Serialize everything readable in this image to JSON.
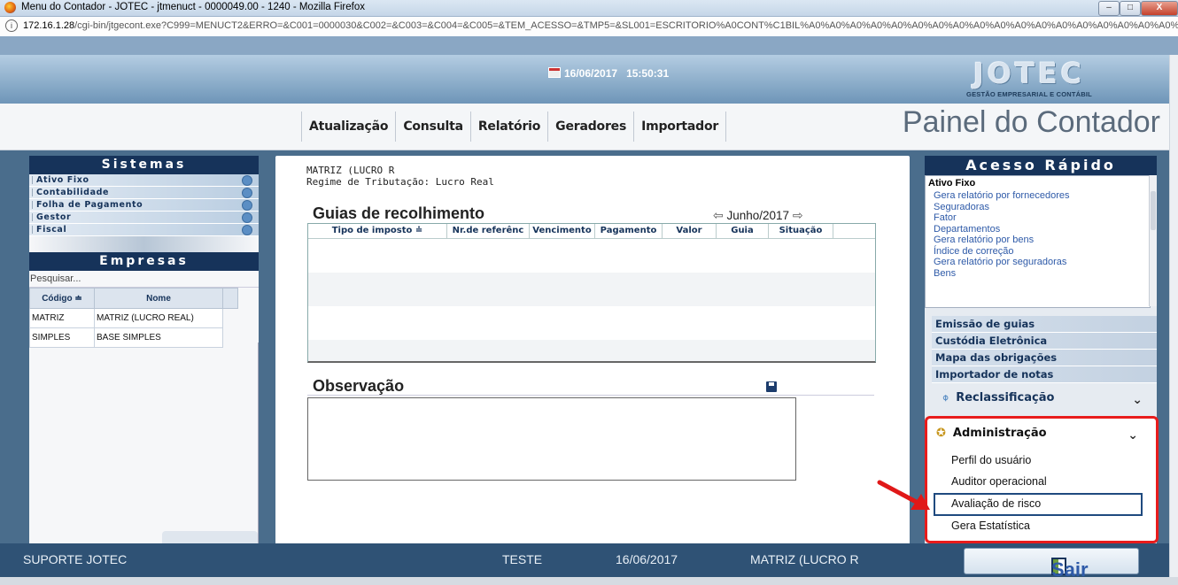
{
  "window": {
    "title": "Menu do Contador - JOTEC - jtmenuct - 0000049.00 - 1240 - Mozilla Firefox",
    "min_label": "‒",
    "max_label": "□",
    "close_label": "X"
  },
  "urlbar": {
    "host": "172.16.1.28",
    "path": "/cgi-bin/jtgecont.exe?C999=MENUCT2&ERRO=&C001=0000030&C002=&C003=&C004=&C005=&TEM_ACESSO=&TMP5=&SL001=ESCRITORIO%A0CONT%C1BIL%A0%A0%A0%A0%A0%A0%A0%A0%A0%A0%A0%A0%A0%A0%A0%A0%A0%A0%A0%"
  },
  "banner": {
    "date": "16/06/2017",
    "time": "15:50:31",
    "logo_text": "JOTEC",
    "logo_subtitle": "GESTÃO EMPRESARIAL E CONTÁBIL"
  },
  "menu": {
    "items": [
      "Atualização",
      "Consulta",
      "Relatório",
      "Geradores",
      "Importador"
    ],
    "page_title": "Painel do Contador"
  },
  "sistemas": {
    "title": "Sistemas",
    "items": [
      "Ativo Fixo",
      "Contabilidade",
      "Folha de Pagamento",
      "Gestor",
      "Fiscal"
    ]
  },
  "empresas": {
    "title": "Empresas",
    "search_placeholder": "Pesquisar...",
    "columns": [
      "Código ≐",
      "Nome"
    ],
    "rows": [
      {
        "codigo": "MATRIZ",
        "nome": "MATRIZ (LUCRO REAL)"
      },
      {
        "codigo": "SIMPLES",
        "nome": "BASE SIMPLES"
      }
    ]
  },
  "center": {
    "company_line": "MATRIZ (LUCRO R",
    "regime_line": "Regime de Tributação: Lucro Real",
    "guias_title": "Guias de recolhimento",
    "month": "Junho/2017",
    "columns": [
      "Tipo de imposto ≐",
      "Nr.de referênc",
      "Vencimento",
      "Pagamento",
      "Valor",
      "Guia",
      "Situação"
    ],
    "obs_title": "Observação"
  },
  "acesso_rapido": {
    "title": "Acesso Rápido",
    "group": "Ativo Fixo",
    "links": [
      "Gera relatório por fornecedores",
      "Seguradoras",
      "Fator",
      "Departamentos",
      "Gera relatório por bens",
      "Índice de correção",
      "Gera relatório por seguradoras",
      "Bens"
    ],
    "buttons": [
      "Emissão de guias",
      "Custódia Eletrônica",
      "Mapa das obrigações",
      "Importador de notas"
    ],
    "reclass": "Reclassificação",
    "admin": {
      "title": "Administração",
      "items": [
        "Perfil do usuário",
        "Auditor operacional",
        "Avaliação de risco",
        "Gera Estatística"
      ]
    }
  },
  "footer": {
    "support": "SUPORTE JOTEC",
    "user": "TESTE",
    "date": "16/06/2017",
    "company": "MATRIZ (LUCRO R",
    "exit": "Sair"
  },
  "colors": {
    "navy": "#16335a",
    "highlight_red": "#e81c1c",
    "link_blue": "#2e5aa8",
    "footer": "#2f5275"
  }
}
